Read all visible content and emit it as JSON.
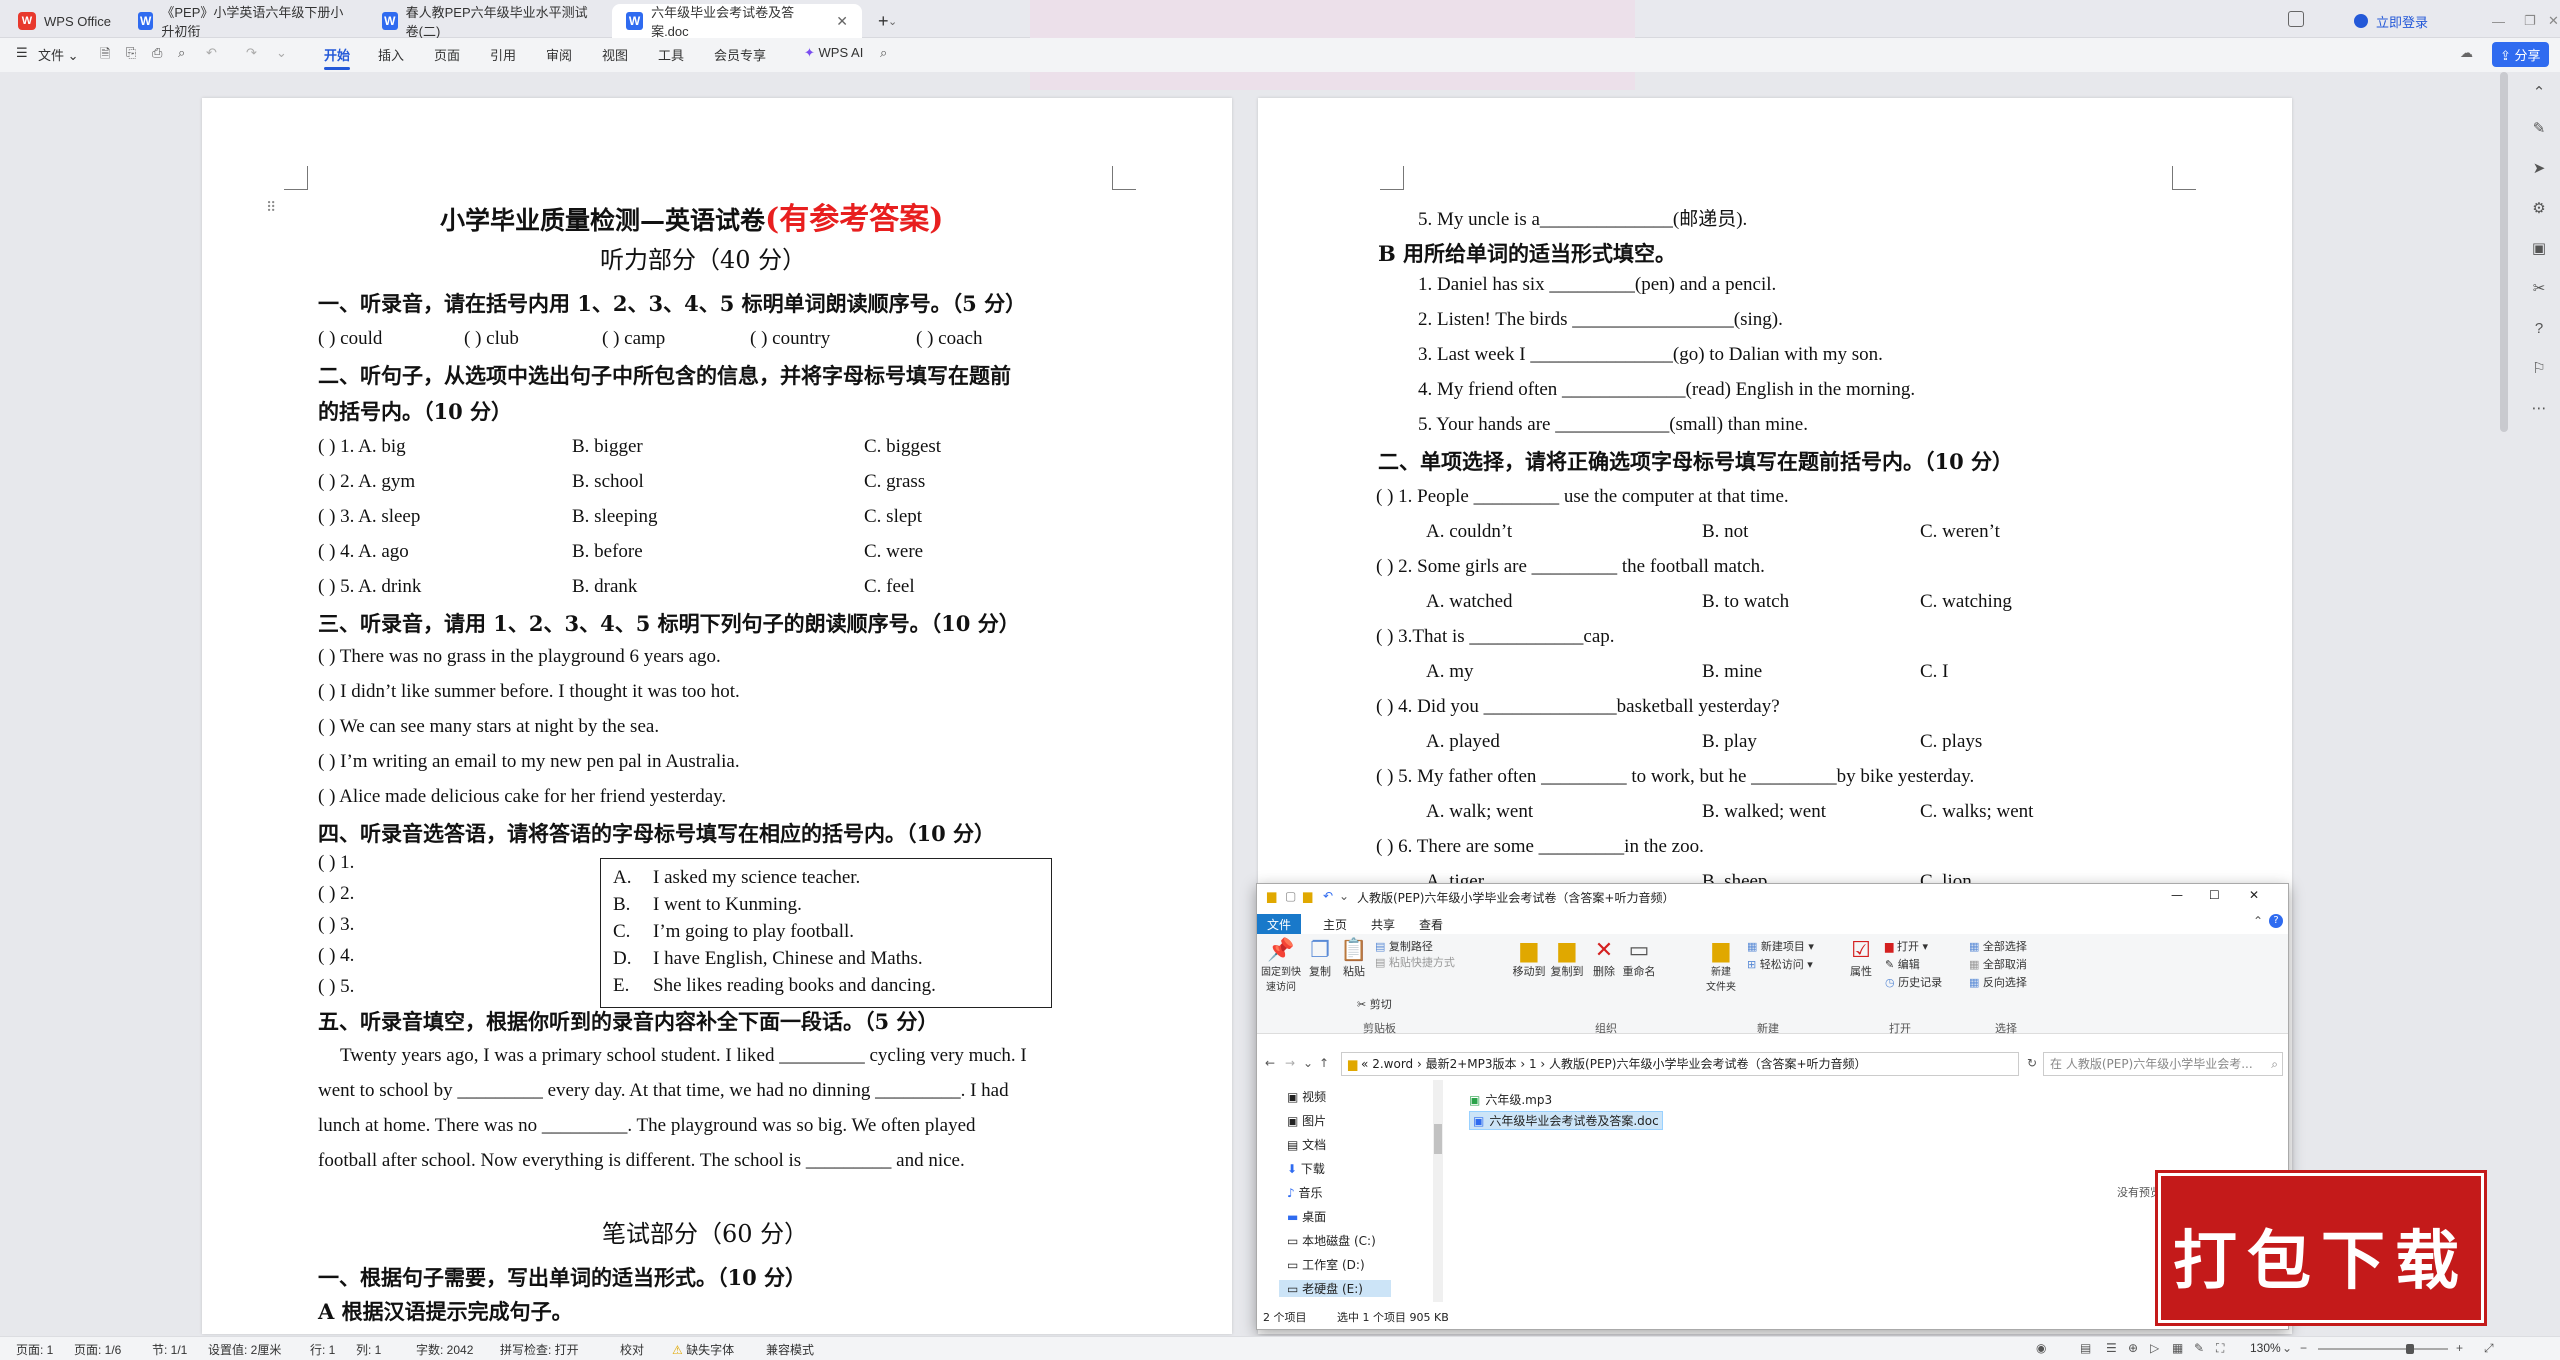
{
  "tabs": [
    {
      "label": "WPS Office"
    },
    {
      "label": "《PEP》小学英语六年级下册小升初衔"
    },
    {
      "label": "春人教PEP六年级毕业水平测试卷(二)"
    },
    {
      "label": "六年级毕业会考试卷及答案.doc"
    }
  ],
  "titlebar": {
    "login": "立即登录",
    "share": "分享"
  },
  "menu": {
    "file": "文件",
    "items": [
      "开始",
      "插入",
      "页面",
      "引用",
      "审阅",
      "视图",
      "工具",
      "会员专享"
    ],
    "ai": "WPS AI"
  },
  "left_page": {
    "title": "小学毕业质量检测—英语试卷",
    "title_red": "(有参考答案)",
    "section_listen": "听力部分（40 分）",
    "q1_head": "一、听录音，请在括号内用 1、2、3、4、5 标明单词朗读顺序号。（5 分）",
    "q1_items": [
      "(    ) could",
      "(    ) club",
      "(    ) camp",
      "(    ) country",
      "(    ) coach"
    ],
    "q2_head1": "二、听句子，从选项中选出句子中所包含的信息，并将字母标号填写在题前",
    "q2_head2": "的括号内。（10 分）",
    "q2_rows": [
      {
        "a": "(    ) 1. A. big",
        "b": "B. bigger",
        "c": "C. biggest"
      },
      {
        "a": "(    ) 2. A. gym",
        "b": "B. school",
        "c": "C. grass"
      },
      {
        "a": "(    ) 3. A. sleep",
        "b": "B. sleeping",
        "c": "C. slept"
      },
      {
        "a": "(    ) 4. A. ago",
        "b": "B. before",
        "c": "C. were"
      },
      {
        "a": "(    ) 5. A. drink",
        "b": "B. drank",
        "c": "C. feel"
      }
    ],
    "q3_head": "三、听录音，请用 1、2、3、4、5 标明下列句子的朗读顺序号。（10 分）",
    "q3_items": [
      "(    ) There was no grass in the playground 6 years ago.",
      "(    ) I didn’t like summer before. I thought it was too hot.",
      "(    ) We can see many stars at night by the sea.",
      "(    ) I’m writing an email to my new pen pal in Australia.",
      "(    ) Alice made delicious cake for her friend yesterday."
    ],
    "q4_head": "四、听录音选答语，请将答语的字母标号填写在相应的括号内。（10 分）",
    "q4_nums": [
      "(    ) 1.",
      "(    ) 2.",
      "(    ) 3.",
      "(    ) 4.",
      "(    ) 5."
    ],
    "q4_options": [
      {
        "letter": "A.",
        "text": "I asked my science teacher."
      },
      {
        "letter": "B.",
        "text": "I went to Kunming."
      },
      {
        "letter": "C.",
        "text": "I’m going to play football."
      },
      {
        "letter": "D.",
        "text": "I have English, Chinese and Maths."
      },
      {
        "letter": "E.",
        "text": "She likes reading books and dancing."
      }
    ],
    "q5_head": "五、听录音填空，根据你听到的录音内容补全下面一段话。（5 分）",
    "q5_lines": [
      "Twenty years ago, I was a primary school student. I liked _________ cycling very much. I",
      "went to school by _________ every day. At that time, we had no dinning _________. I had",
      "lunch at home. There was no _________. The playground was so big. We often played",
      "football after school. Now everything is different. The school is _________ and nice."
    ],
    "section_write": "笔试部分（60 分）",
    "w1_head": "一、根据句子需要，写出单词的适当形式。（10 分）",
    "w1_sub": "A 根据汉语提示完成句子。"
  },
  "right_page": {
    "lines_top": [
      "5.   My uncle is a______________(邮递员)."
    ],
    "b_head": "B 用所给单词的适当形式填空。",
    "b_items": [
      "1. Daniel has six _________(pen) and a pencil.",
      "2. Listen! The birds _________________(sing).",
      "3. Last week I _______________(go) to Dalian with my son.",
      "4. My friend often _____________(read) English in the morning.",
      "5. Your hands are ____________(small) than mine."
    ],
    "mc_head": "二、单项选择，请将正确选项字母标号填写在题前括号内。（10 分）",
    "mc": [
      {
        "q": "(     ) 1. People _________ use the computer at that time.",
        "a": "A. couldn’t",
        "b": "B. not",
        "c": "C. weren’t"
      },
      {
        "q": "(     ) 2. Some girls are _________ the football match.",
        "a": "A. watched",
        "b": "B. to watch",
        "c": "C. watching"
      },
      {
        "q": "(     ) 3.That is ____________cap.",
        "a": "A. my",
        "b": "B. mine",
        "c": "C. I"
      },
      {
        "q": "(     ) 4. Did you ______________basketball yesterday?",
        "a": "A. played",
        "b": "B. play",
        "c": "C. plays"
      },
      {
        "q": "(     ) 5. My father often _________ to work, but he _________by bike yesterday.",
        "a": "A. walk;    went",
        "b": "B. walked;    went",
        "c": "C. walks;    went"
      },
      {
        "q": "(     ) 6. There are some _________in the zoo.",
        "a": "A. tiger",
        "b": "B. sheep",
        "c": "C. lion"
      }
    ]
  },
  "explorer": {
    "title": "人教版(PEP)六年级小学毕业会考试卷（含答案+听力音频）",
    "tabs": [
      "文件",
      "主页",
      "共享",
      "查看"
    ],
    "ribbon": {
      "pin": "固定到快\n速访问",
      "copy": "复制",
      "paste": "粘贴",
      "copy_path": "复制路径",
      "paste_shortcut": "粘贴快捷方式",
      "cut": "剪切",
      "move_to": "移动到",
      "copy_to": "复制到",
      "delete": "删除",
      "rename": "重命名",
      "new_folder": "新建\n文件夹",
      "new_item": "新建项目",
      "easy_access": "轻松访问",
      "properties": "属性",
      "open": "打开",
      "edit": "编辑",
      "history": "历史记录",
      "select_all": "全部选择",
      "select_none": "全部取消",
      "invert": "反向选择",
      "groups": [
        "剪贴板",
        "组织",
        "新建",
        "打开",
        "选择"
      ]
    },
    "path": [
      "2.word",
      "最新2+MP3版本",
      "1",
      "人教版(PEP)六年级小学毕业会考试卷（含答案+听力音频）"
    ],
    "search_placeholder": "在 人教版(PEP)六年级小学毕业会考...",
    "nav": [
      "视频",
      "图片",
      "文档",
      "下载",
      "音乐",
      "桌面",
      "本地磁盘 (C:)",
      "工作室 (D:)",
      "老硬盘 (E:)"
    ],
    "files": [
      {
        "name": "六年级.mp3"
      },
      {
        "name": "六年级毕业会考试卷及答案.doc"
      }
    ],
    "no_preview": "没有预览",
    "status": {
      "count": "2 个项目",
      "selected": "选中 1 个项目  905 KB"
    }
  },
  "promo": {
    "text": "打包下载"
  },
  "statusbar": {
    "page": "页面: 1",
    "pages": "页面: 1/6",
    "section": "节: 1/1",
    "setting": "设置值: 2厘米",
    "row": "行: 1",
    "col": "列: 1",
    "words": "字数: 2042",
    "spell": "拼写检查: 打开",
    "proof": "校对",
    "font_missing": "缺失字体",
    "compat": "兼容模式",
    "zoom": "130%"
  },
  "colors": {
    "accent": "#2459d8",
    "red": "#e81f1f",
    "promo": "#c41a1a"
  }
}
